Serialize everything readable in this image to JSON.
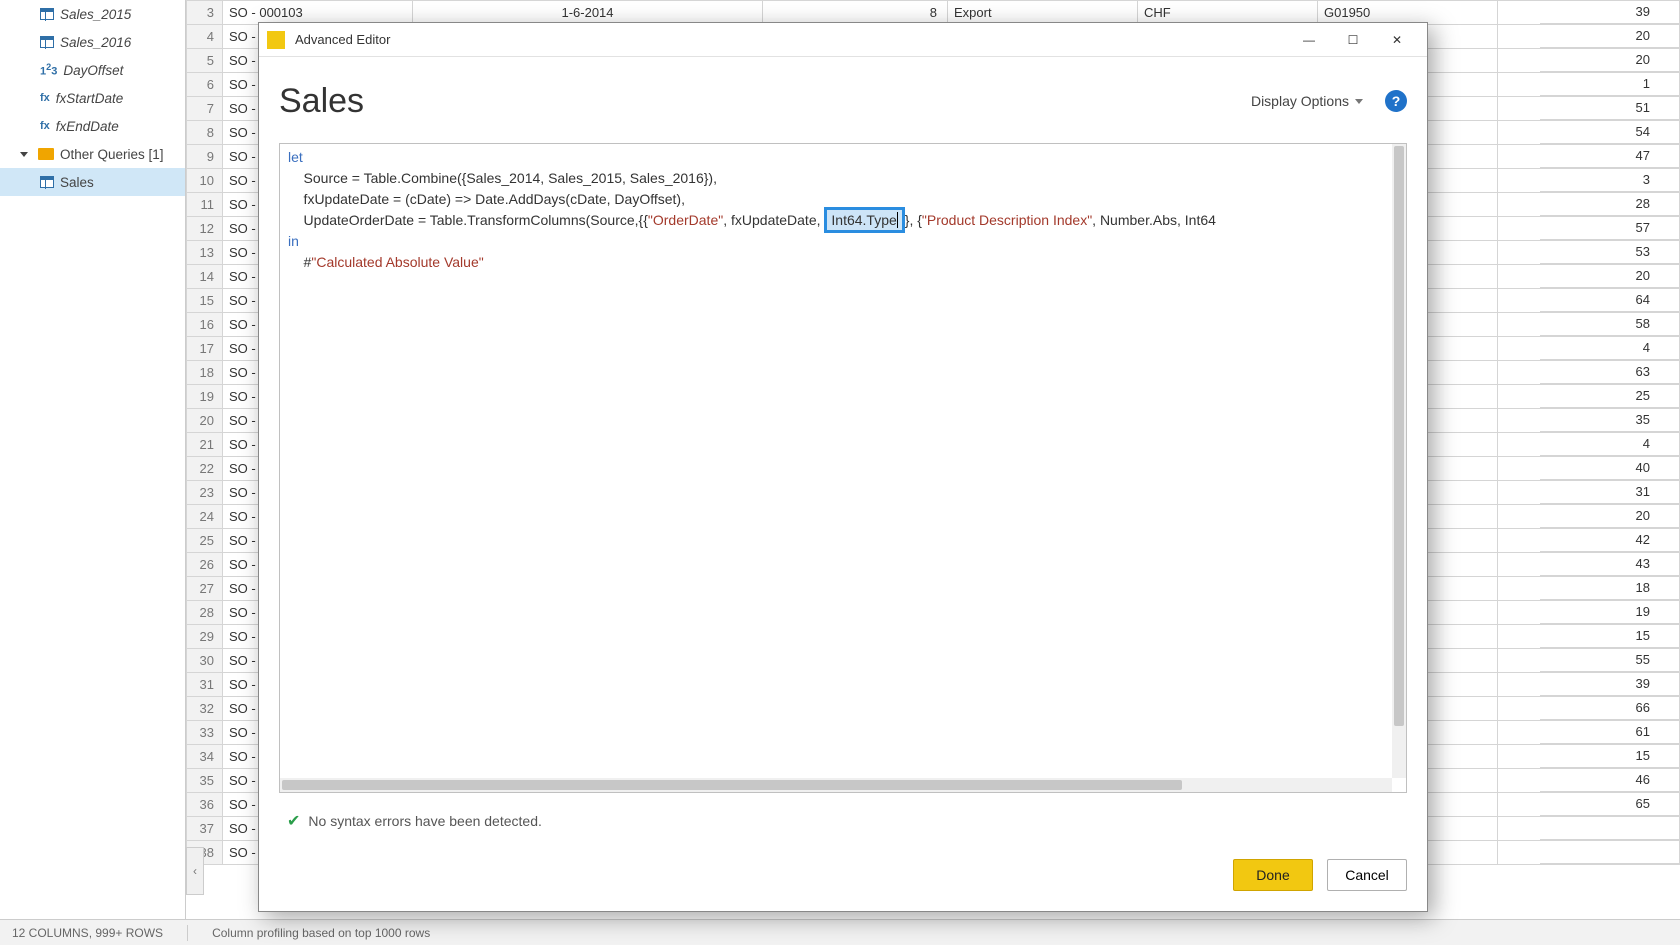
{
  "tree": {
    "items": [
      {
        "label": "Sales_2015",
        "icon": "table"
      },
      {
        "label": "Sales_2016",
        "icon": "table"
      },
      {
        "label": "DayOffset",
        "icon": "num"
      },
      {
        "label": "fxStartDate",
        "icon": "fx"
      },
      {
        "label": "fxEndDate",
        "icon": "fx"
      }
    ],
    "folder_label": "Other Queries [1]",
    "selected_label": "Sales"
  },
  "grid": {
    "header": {
      "rownum": "3",
      "so": "SO - 000103",
      "date": "1-6-2014",
      "eight": "8",
      "export": "Export",
      "curr": "CHF",
      "code": "G01950",
      "rval": "39"
    },
    "rows": [
      {
        "n": "4",
        "so": "SO -",
        "r": "20"
      },
      {
        "n": "5",
        "so": "SO -",
        "r": "20"
      },
      {
        "n": "6",
        "so": "SO -",
        "r": "1"
      },
      {
        "n": "7",
        "so": "SO -",
        "r": "51"
      },
      {
        "n": "8",
        "so": "SO -",
        "r": "54"
      },
      {
        "n": "9",
        "so": "SO -",
        "r": "47"
      },
      {
        "n": "10",
        "so": "SO -",
        "r": "3"
      },
      {
        "n": "11",
        "so": "SO -",
        "r": "28"
      },
      {
        "n": "12",
        "so": "SO -",
        "r": "57"
      },
      {
        "n": "13",
        "so": "SO -",
        "r": "53"
      },
      {
        "n": "14",
        "so": "SO -",
        "r": "20"
      },
      {
        "n": "15",
        "so": "SO -",
        "r": "64"
      },
      {
        "n": "16",
        "so": "SO -",
        "r": "58"
      },
      {
        "n": "17",
        "so": "SO -",
        "r": "4"
      },
      {
        "n": "18",
        "so": "SO -",
        "r": "63"
      },
      {
        "n": "19",
        "so": "SO -",
        "r": "25"
      },
      {
        "n": "20",
        "so": "SO -",
        "r": "35"
      },
      {
        "n": "21",
        "so": "SO -",
        "r": "4"
      },
      {
        "n": "22",
        "so": "SO -",
        "r": "40"
      },
      {
        "n": "23",
        "so": "SO -",
        "r": "31"
      },
      {
        "n": "24",
        "so": "SO -",
        "r": "20"
      },
      {
        "n": "25",
        "so": "SO -",
        "r": "42"
      },
      {
        "n": "26",
        "so": "SO -",
        "r": "43"
      },
      {
        "n": "27",
        "so": "SO -",
        "r": "18"
      },
      {
        "n": "28",
        "so": "SO -",
        "r": "19"
      },
      {
        "n": "29",
        "so": "SO -",
        "r": "15"
      },
      {
        "n": "30",
        "so": "SO -",
        "r": "55"
      },
      {
        "n": "31",
        "so": "SO -",
        "r": "39"
      },
      {
        "n": "32",
        "so": "SO -",
        "r": "66"
      },
      {
        "n": "33",
        "so": "SO -",
        "r": "61"
      },
      {
        "n": "34",
        "so": "SO -",
        "r": "15"
      },
      {
        "n": "35",
        "so": "SO -",
        "r": "46"
      },
      {
        "n": "36",
        "so": "SO -",
        "r": "65"
      },
      {
        "n": "37",
        "so": "SO -",
        "r": ""
      },
      {
        "n": "38",
        "so": "SO -",
        "r": ""
      }
    ]
  },
  "status": {
    "cols_rows": "12 COLUMNS, 999+ ROWS",
    "profiling": "Column profiling based on top 1000 rows"
  },
  "modal": {
    "title": "Advanced Editor",
    "query_name": "Sales",
    "display_options": "Display Options",
    "help_glyph": "?",
    "code": {
      "l1": "let",
      "l2_a": "    Source = Table.Combine({Sales_2014, Sales_2015, Sales_2016}),",
      "l3_a": "    fxUpdateDate = (cDate) => Date.AddDays(cDate, DayOffset),",
      "l4_pre": "    UpdateOrderDate = Table.TransformColumns(Source,{{",
      "l4_str1": "\"OrderDate\"",
      "l4_mid1": ", fxUpdateDate, ",
      "l4_highlight": "Int64.Type",
      "l4_mid2": "}, {",
      "l4_str2": "\"Product Description Index\"",
      "l4_mid3": ", Number.Abs, Int64",
      "l5": "in",
      "l6_a": "    #",
      "l6_str": "\"Calculated Absolute Value\""
    },
    "syntax_msg": "No syntax errors have been detected.",
    "done_label": "Done",
    "cancel_label": "Cancel"
  }
}
